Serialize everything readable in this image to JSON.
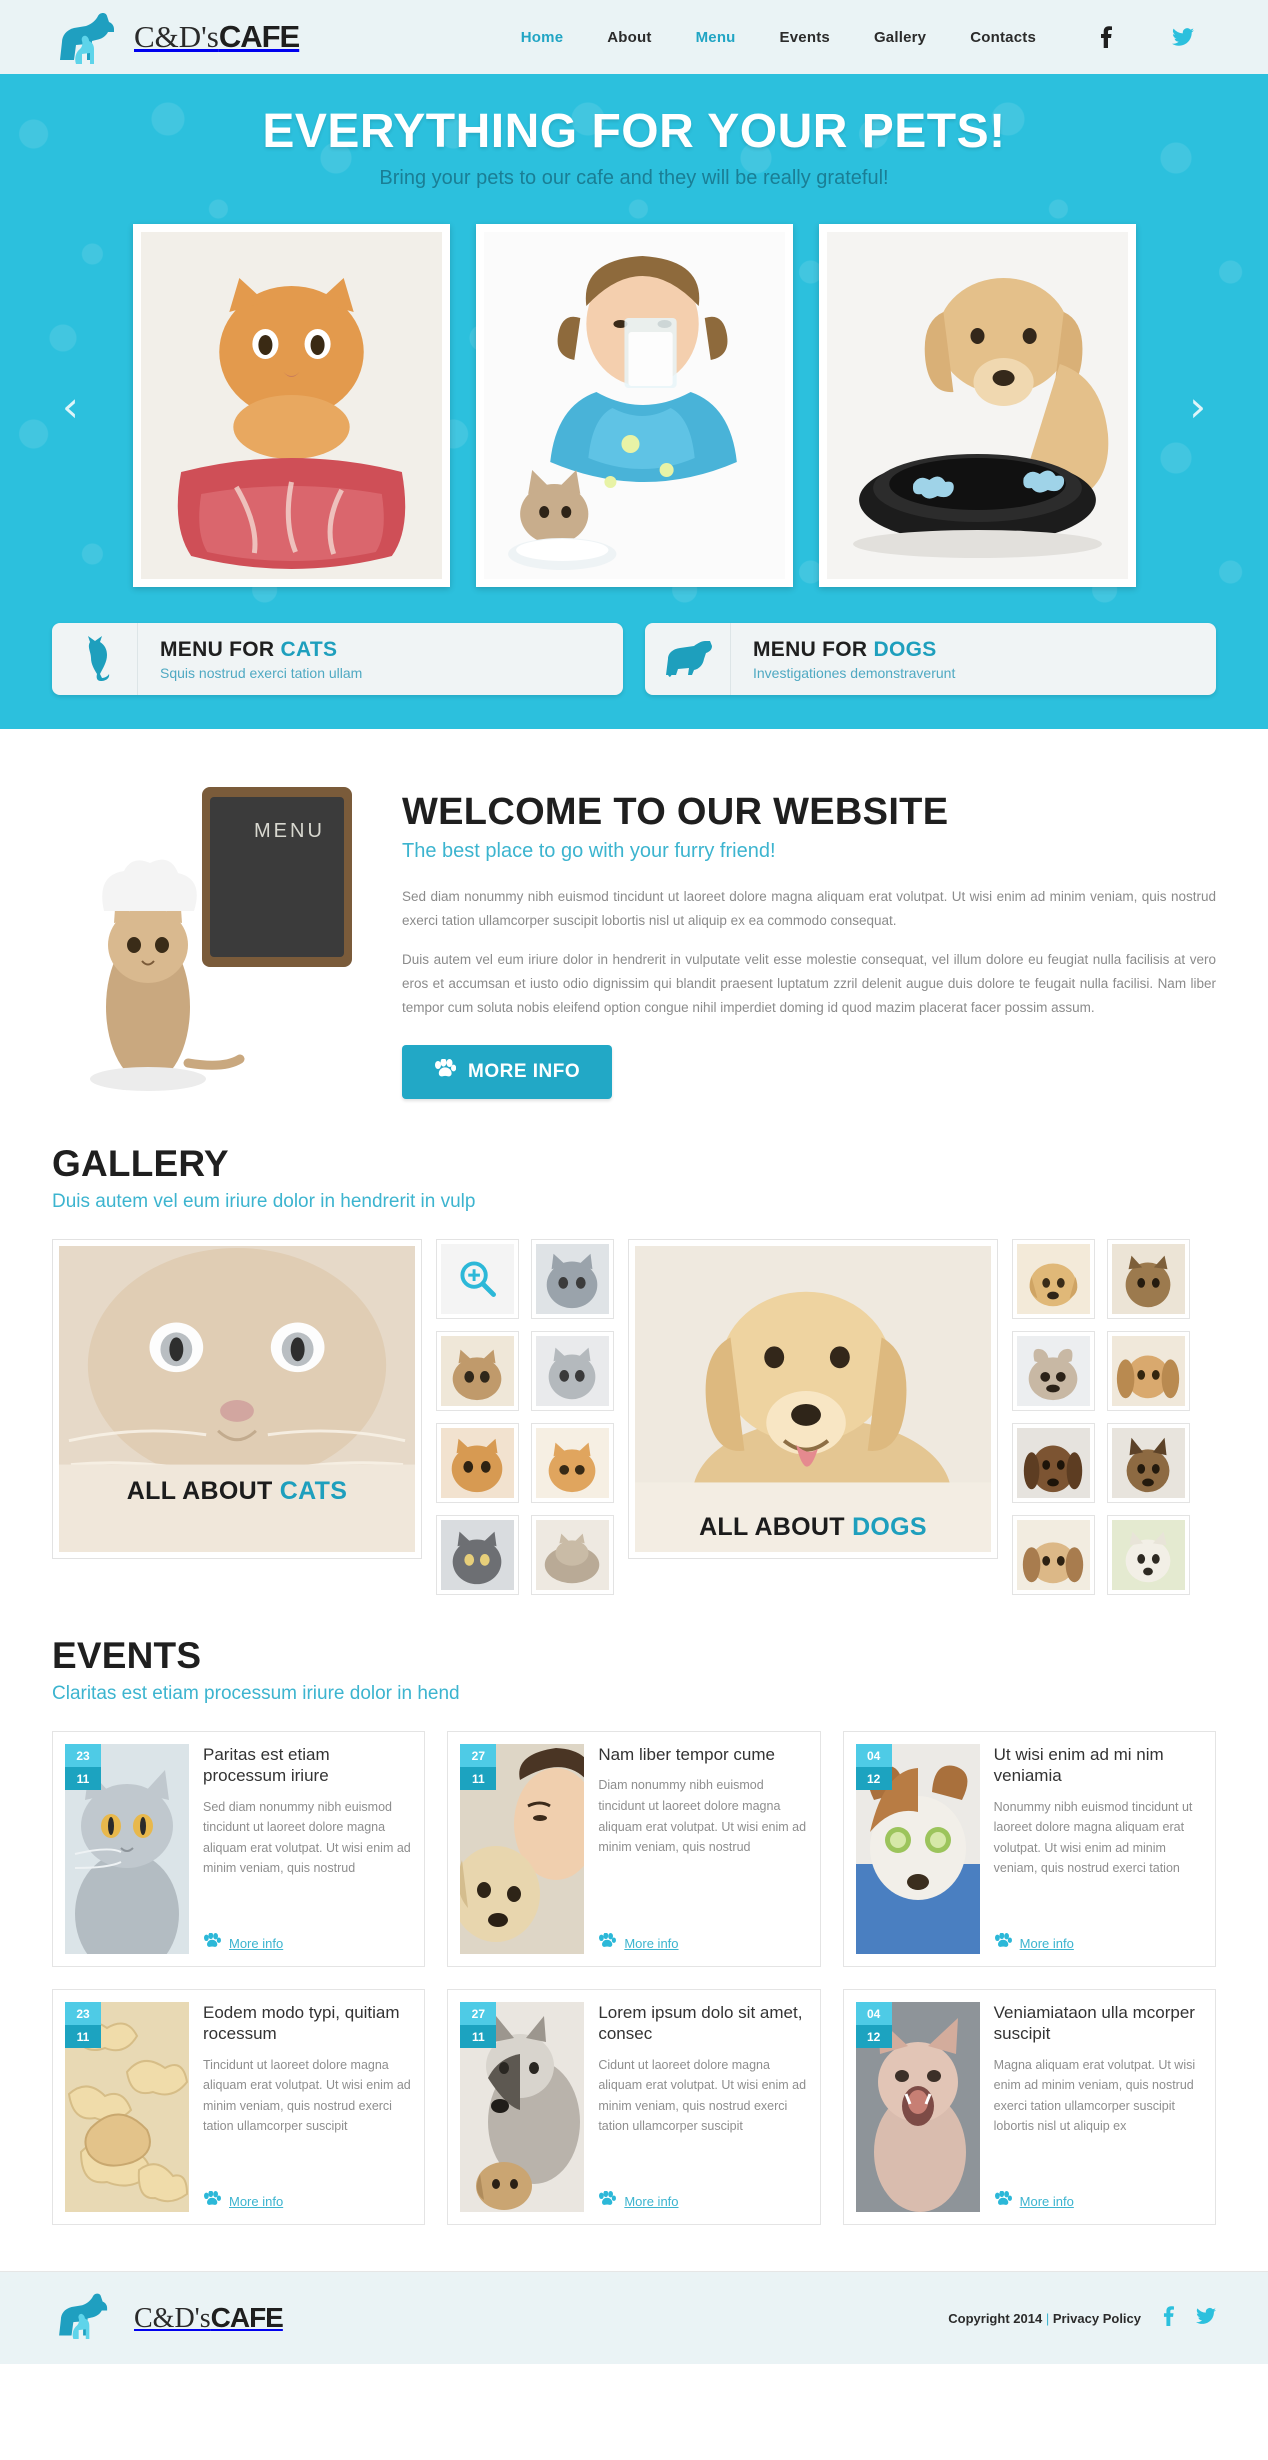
{
  "brand": {
    "thin": "C&D's",
    "bold": "CAFE",
    "mark": "dog-cat-silhouette-icon"
  },
  "nav": {
    "items": [
      {
        "label": "Home",
        "active": true
      },
      {
        "label": "About",
        "active": false
      },
      {
        "label": "Menu",
        "active": true
      },
      {
        "label": "Events",
        "active": false
      },
      {
        "label": "Gallery",
        "active": false
      },
      {
        "label": "Contacts",
        "active": false
      }
    ],
    "social": [
      {
        "name": "facebook-icon",
        "color": "#1f1f1f"
      },
      {
        "name": "twitter-icon",
        "color": "#2cc0dd"
      }
    ]
  },
  "hero": {
    "title": "EVERYTHING FOR YOUR PETS!",
    "subtitle": "Bring your pets to our cafe and they will be really grateful!",
    "prev": "‹",
    "next": "›",
    "slides": [
      {
        "alt": "ginger-cat-with-raw-meat"
      },
      {
        "alt": "girl-drinking-milk-with-kitten"
      },
      {
        "alt": "puppy-eating-from-black-bowl"
      }
    ],
    "background": "#2cc0dd"
  },
  "menubars": [
    {
      "icon": "cat-silhouette-icon",
      "title_plain": "MENU FOR ",
      "title_hl": "CATS",
      "subtitle": "Squis nostrud exerci tation ullam"
    },
    {
      "icon": "dog-silhouette-icon",
      "title_plain": "MENU FOR ",
      "title_hl": "DOGS",
      "subtitle": "Investigationes demonstraverunt"
    }
  ],
  "welcome": {
    "image_alt": "cat-in-chef-hat-with-menu-chalkboard",
    "chalkboard_text": "MENU",
    "title": "WELCOME TO OUR WEBSITE",
    "subtitle": "The best place to go with your furry friend!",
    "paragraph1": "Sed diam nonummy nibh euismod tincidunt ut laoreet dolore magna aliquam erat volutpat. Ut wisi enim ad minim veniam, quis nostrud exerci tation ullamcorper suscipit lobortis nisl ut aliquip ex ea commodo consequat.",
    "paragraph2": "Duis autem vel eum iriure dolor in hendrerit in vulputate velit esse molestie consequat, vel illum dolore eu feugiat nulla facilisis at vero eros et accumsan et iusto odio dignissim qui blandit praesent luptatum zzril delenit augue duis dolore te feugait nulla facilisi. Nam liber tempor cum soluta nobis eleifend option congue nihil imperdiet doming id quod mazim placerat facer possim assum.",
    "button_label": "MORE INFO",
    "button_icon": "paw-icon"
  },
  "gallery": {
    "title": "GALLERY",
    "subtitle": "Duis autem vel eum iriure dolor in hendrerit in vulp",
    "cats": {
      "caption_plain": "ALL ABOUT ",
      "caption_hl": "CATS",
      "image_alt": "close-up-cream-cat-face",
      "thumbs": [
        {
          "alt": "magnifier-thumb",
          "icon": "zoom-icon"
        },
        {
          "alt": "grey-british-cat"
        },
        {
          "alt": "tabby-kitten"
        },
        {
          "alt": "grey-kitten"
        },
        {
          "alt": "ginger-cat-closeup"
        },
        {
          "alt": "orange-cat-portrait"
        },
        {
          "alt": "dark-kitten"
        },
        {
          "alt": "sleeping-cat"
        }
      ]
    },
    "dogs": {
      "caption_plain": "ALL ABOUT ",
      "caption_hl": "DOGS",
      "image_alt": "golden-labrador-smiling",
      "thumbs": [
        {
          "alt": "golden-retriever-puppy"
        },
        {
          "alt": "yorkshire-terrier"
        },
        {
          "alt": "french-bulldog"
        },
        {
          "alt": "cocker-spaniel"
        },
        {
          "alt": "dachshund-portrait"
        },
        {
          "alt": "german-shepherd"
        },
        {
          "alt": "beagle-puppy"
        },
        {
          "alt": "white-terrier"
        }
      ]
    }
  },
  "events": {
    "title": "EVENTS",
    "subtitle": "Claritas est etiam processum iriure dolor in hend",
    "more_label": "More info",
    "more_icon": "paw-icon",
    "cards": [
      {
        "day": "23",
        "month": "11",
        "image_alt": "grey-british-shorthair-cat",
        "title": "Paritas est etiam processum iriure",
        "text": "Sed diam nonummy nibh euismod tincidunt ut laoreet dolore magna aliquam erat volutpat. Ut wisi enim ad minim veniam, quis nostrud"
      },
      {
        "day": "27",
        "month": "11",
        "image_alt": "woman-hugging-golden-dog",
        "title": "Nam liber tempor cume",
        "text": "Diam nonummy nibh euismod tincidunt ut laoreet dolore magna aliquam erat volutpat. Ut wisi enim ad minim veniam, quis nostrud"
      },
      {
        "day": "04",
        "month": "12",
        "image_alt": "dog-with-cucumber-spa-mask",
        "title": "Ut wisi enim ad mi nim veniamia",
        "text": "Nonummy nibh euismod tincidunt ut laoreet dolore magna aliquam erat volutpat. Ut wisi enim ad minim veniam, quis nostrud exerci tation"
      },
      {
        "day": "23",
        "month": "11",
        "image_alt": "bone-shaped-dog-biscuits",
        "title": "Eodem modo typi, quitiam rocessum",
        "text": "Tincidunt ut laoreet dolore magna aliquam erat volutpat. Ut wisi enim ad minim veniam, quis nostrud exerci tation ullamcorper suscipit"
      },
      {
        "day": "27",
        "month": "11",
        "image_alt": "husky-and-puppy",
        "title": "Lorem ipsum dolo sit amet, consec",
        "text": "Cidunt ut laoreet dolore magna aliquam erat volutpat. Ut wisi enim ad minim veniam, quis nostrud exerci tation ullamcorper suscipit"
      },
      {
        "day": "04",
        "month": "12",
        "image_alt": "sphynx-cat-yawning",
        "title": "Veniamiataon ulla mcorper suscipit",
        "text": "Magna aliquam erat volutpat. Ut wisi enim ad minim veniam, quis nostrud exerci tation ullamcorper suscipit lobortis nisl ut aliquip ex"
      }
    ]
  },
  "footer": {
    "copyright": "Copyright 2014",
    "separator": "|",
    "privacy_label": "Privacy Policy",
    "social": [
      {
        "name": "facebook-icon",
        "color": "#2cc0dd"
      },
      {
        "name": "twitter-icon",
        "color": "#2cc0dd"
      }
    ]
  },
  "colors": {
    "accent": "#2cc0dd",
    "accent_dark": "#1e9fbd",
    "header_bg": "#eaf3f5",
    "text_dark": "#1f1f1f",
    "text_muted": "#8b8b8b"
  }
}
